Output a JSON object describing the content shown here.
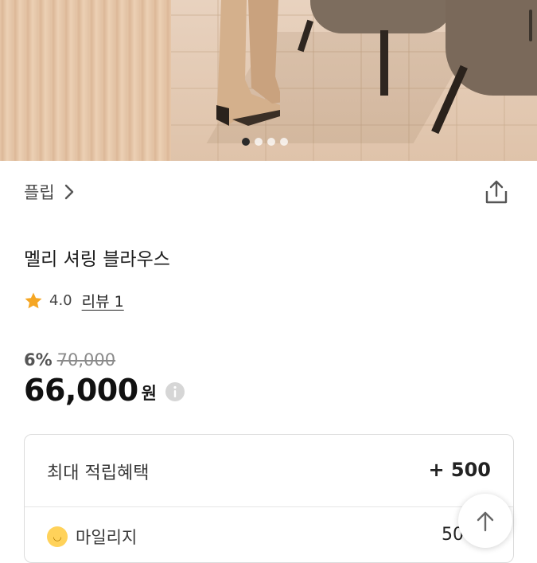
{
  "gallery": {
    "slide_count": 4,
    "active_index": 0
  },
  "brand": {
    "name": "플립"
  },
  "product": {
    "title": "멜리 셔링 블라우스"
  },
  "rating": {
    "score": "4.0",
    "review_link": "리뷰 1"
  },
  "price": {
    "discount": "6%",
    "original": "70,000",
    "current": "66,000",
    "currency": "원"
  },
  "points": {
    "heading": "최대 적립혜택",
    "total": "+ 500",
    "mileage_label": "마일리지",
    "mileage_value": "50"
  },
  "colors": {
    "star": "#f5a623",
    "mileage_coin": "#ffd25a"
  },
  "icons": [
    "chevron-right-icon",
    "share-icon",
    "star-icon",
    "info-icon",
    "coin-icon",
    "arrow-up-icon"
  ]
}
